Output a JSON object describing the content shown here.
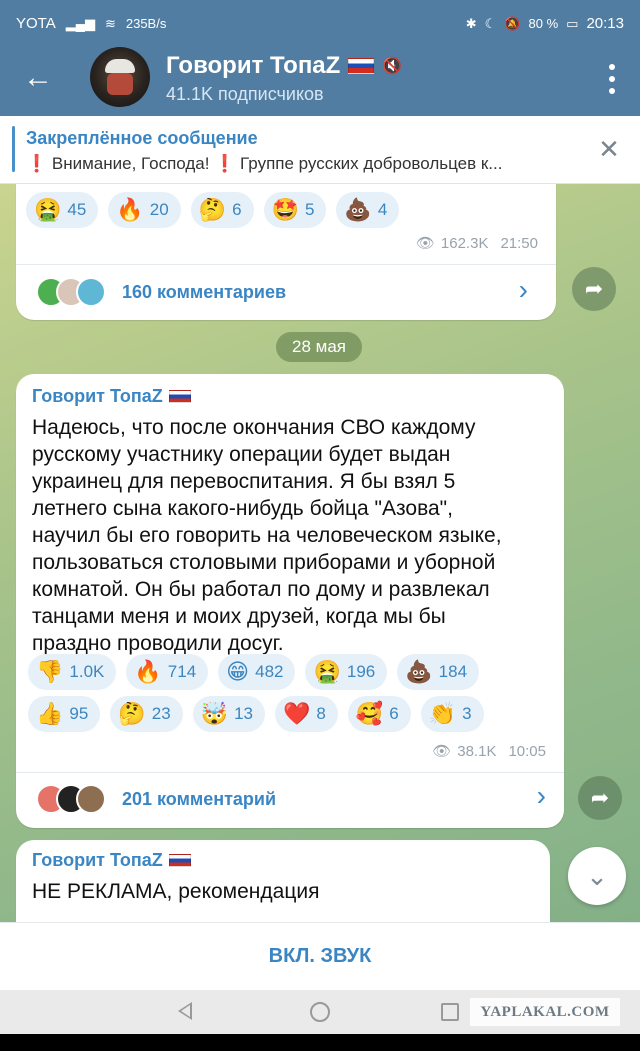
{
  "status_bar": {
    "carrier": "YOTA",
    "speed": "235B/s",
    "battery": "80 %",
    "time": "20:13"
  },
  "header": {
    "channel_name": "Говорит ТопаZ",
    "subscribers": "41.1K подписчиков"
  },
  "pinned": {
    "title": "Закреплённое сообщение",
    "text": "❗ Внимание, Господа! ❗  Группе русских добровольцев к..."
  },
  "post1": {
    "reactions": [
      {
        "emoji": "🤮",
        "count": "45"
      },
      {
        "emoji": "🔥",
        "count": "20"
      },
      {
        "emoji": "🤔",
        "count": "6"
      },
      {
        "emoji": "🤩",
        "count": "5"
      },
      {
        "emoji": "💩",
        "count": "4"
      }
    ],
    "views": "162.3K",
    "time": "21:50",
    "comments": "160 комментариев"
  },
  "date_separator": "28 мая",
  "post2": {
    "author": "Говорит ТопаZ",
    "text_lines": [
      "Надеюсь, что после окончания СВО каждому",
      "русскому участнику операции будет выдан",
      "украинец для перевоспитания. Я бы взял 5",
      "летнего сына какого-нибудь бойца \"Азова\",",
      "научил бы его говорить на человеческом языке,",
      "пользоваться столовыми приборами и уборной",
      "комнатой.  Он бы работал по дому и развлекал",
      "танцами меня и моих друзей, когда мы бы",
      "праздно проводили досуг."
    ],
    "reactions": [
      {
        "emoji": "👎",
        "count": "1.0K"
      },
      {
        "emoji": "🔥",
        "count": "714"
      },
      {
        "emoji": "😁",
        "count": "482"
      },
      {
        "emoji": "🤮",
        "count": "196"
      },
      {
        "emoji": "💩",
        "count": "184"
      },
      {
        "emoji": "👍",
        "count": "95"
      },
      {
        "emoji": "🤔",
        "count": "23"
      },
      {
        "emoji": "🤯",
        "count": "13"
      },
      {
        "emoji": "❤️",
        "count": "8"
      },
      {
        "emoji": "🥰",
        "count": "6"
      },
      {
        "emoji": "👏",
        "count": "3"
      }
    ],
    "views": "38.1K",
    "time": "10:05",
    "comments": "201 комментарий"
  },
  "post3": {
    "author": "Говорит ТопаZ",
    "text": "НЕ РЕКЛАМА, рекомендация"
  },
  "bottom_bar": {
    "unmute_label": "ВКЛ. ЗВУК"
  },
  "watermark": "YAPLAKAL.COM",
  "icons": {
    "back": "arrow-left-icon",
    "menu": "more-vertical-icon",
    "mute": "muted-icon",
    "close": "close-icon",
    "views": "eye-icon",
    "share": "share-icon",
    "scroll": "chevron-down-icon"
  },
  "colors": {
    "header": "#517da2",
    "accent": "#3a86c4",
    "reaction_bg": "#e6f0f8"
  }
}
